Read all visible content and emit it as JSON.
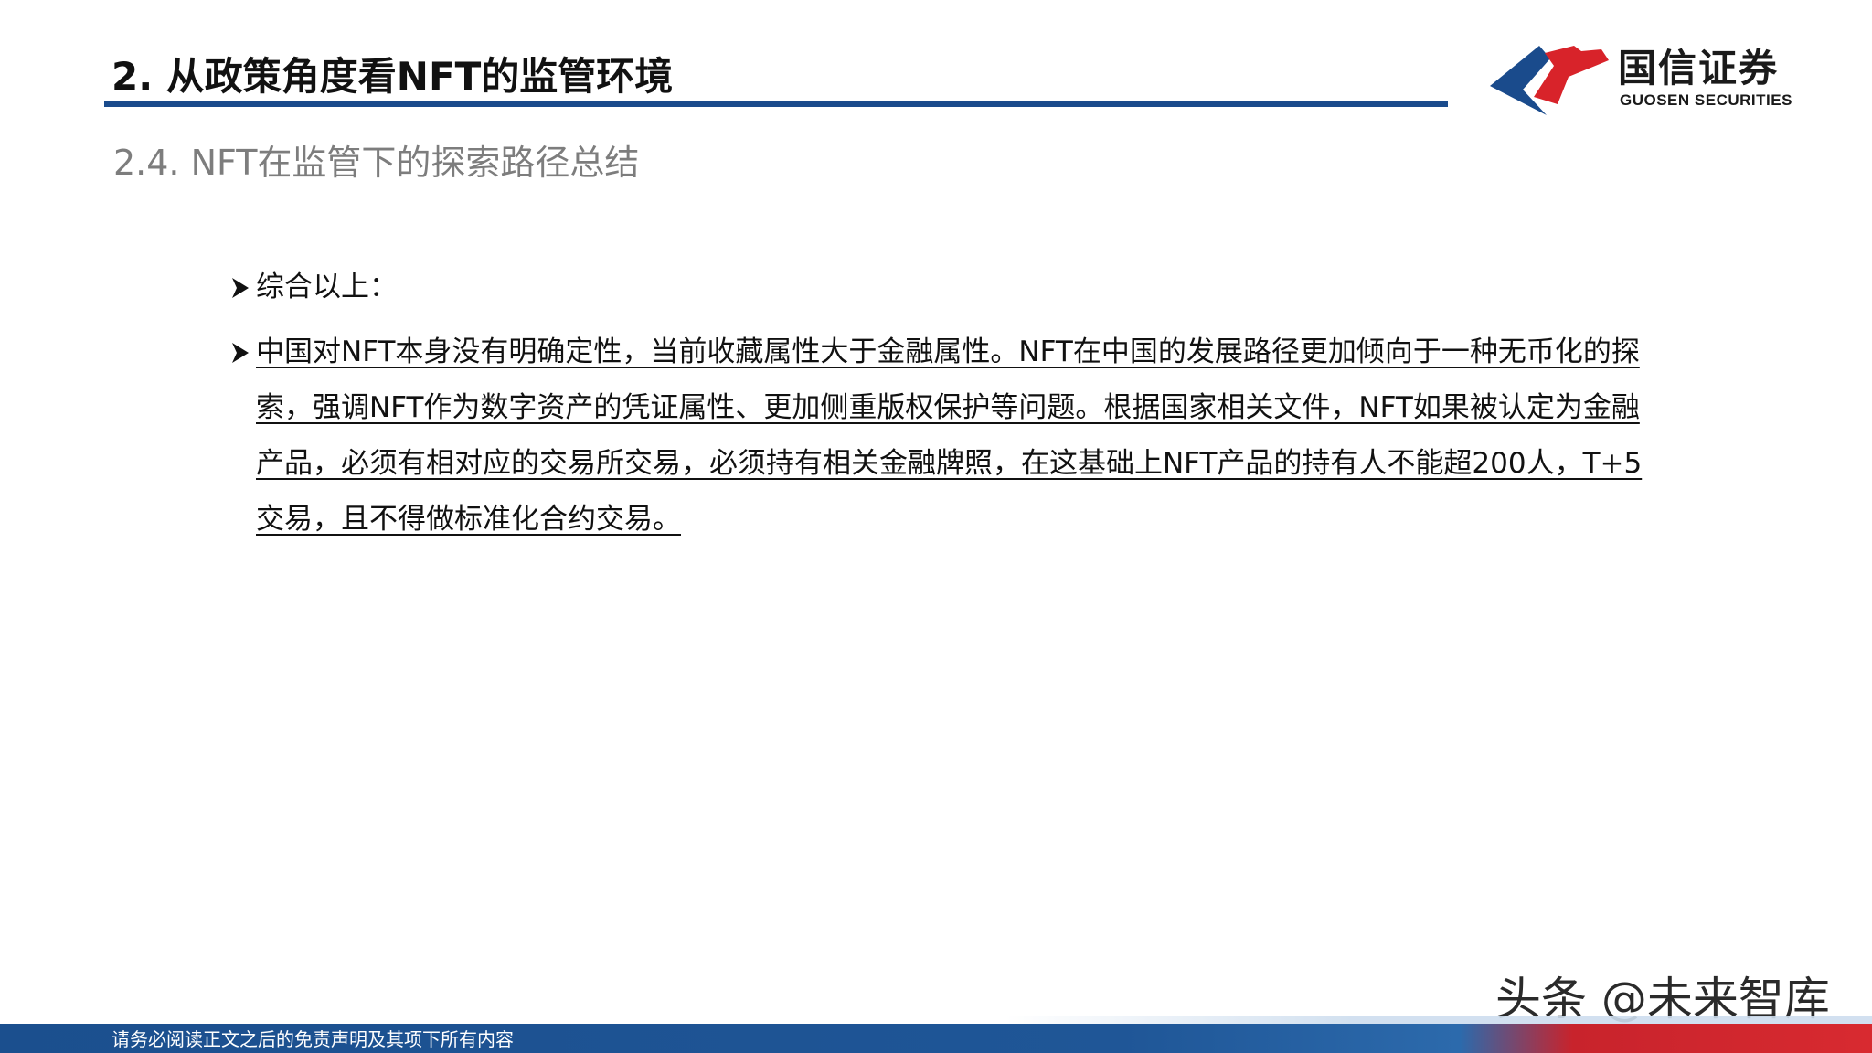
{
  "header": {
    "title": "2. 从政策角度看NFT的监管环境",
    "logo": {
      "icon": "guosen-logo-mark",
      "name_cn": "国信证券",
      "name_en": "GUOSEN SECURITIES",
      "colors": {
        "blue": "#1a4b8c",
        "red": "#d8232a"
      }
    }
  },
  "section": {
    "heading": "2.4.  NFT在监管下的探索路径总结"
  },
  "content": {
    "bullets": [
      {
        "icon": "arrow-bullet-icon",
        "text": "综合以上："
      },
      {
        "icon": "arrow-bullet-icon",
        "text": "中国对NFT本身没有明确定性，当前收藏属性大于金融属性。NFT在中国的发展路径更加倾向于一种无币化的探索，强调NFT作为数字资产的凭证属性、更加侧重版权保护等问题。根据国家相关文件，NFT如果被认定为金融产品，必须有相对应的交易所交易，必须持有相关金融牌照，在这基础上NFT产品的持有人不能超200人，T+5交易，且不得做标准化合约交易。"
      }
    ]
  },
  "watermark": "头条 @未来智库",
  "footer": {
    "disclaimer": "请务必阅读正文之后的免责声明及其项下所有内容"
  },
  "colors": {
    "accent_blue": "#1a4b8c",
    "accent_red": "#d8232a",
    "heading_gray": "#7d7d7d"
  }
}
